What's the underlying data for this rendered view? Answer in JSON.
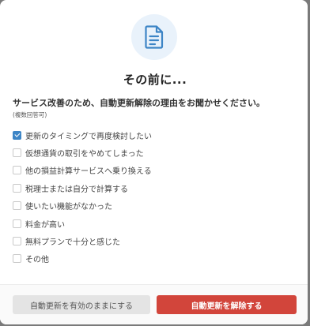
{
  "modal": {
    "icon": "document-icon",
    "title": "その前に...",
    "lead": "サービス改善のため、自動更新解除の理由をお聞かせください。",
    "sub": "(複数回答可)",
    "options": [
      {
        "label": "更新のタイミングで再度検討したい",
        "checked": true
      },
      {
        "label": "仮想通貨の取引をやめてしまった",
        "checked": false
      },
      {
        "label": "他の損益計算サービスへ乗り換える",
        "checked": false
      },
      {
        "label": "税理士または自分で計算する",
        "checked": false
      },
      {
        "label": "使いたい機能がなかった",
        "checked": false
      },
      {
        "label": "料金が高い",
        "checked": false
      },
      {
        "label": "無料プランで十分と感じた",
        "checked": false
      },
      {
        "label": "その他",
        "checked": false
      }
    ],
    "buttons": {
      "keep_label": "自動更新を有効のままにする",
      "cancel_label": "自動更新を解除する"
    }
  },
  "colors": {
    "accent": "#3d85c6",
    "danger": "#d2453b",
    "icon_bg": "#e9f2fb"
  }
}
